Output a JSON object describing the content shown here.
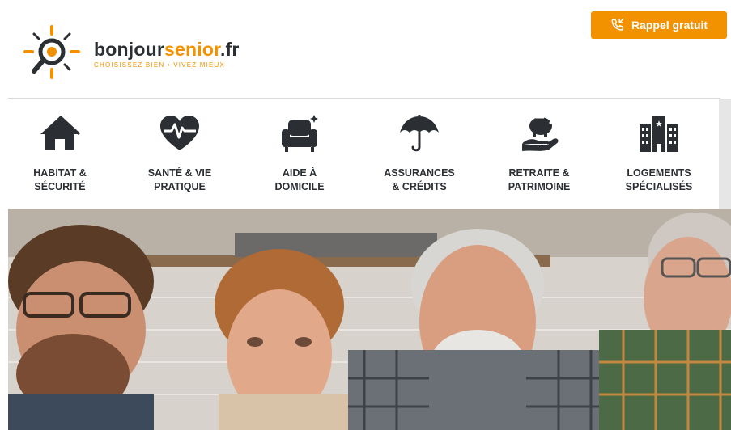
{
  "brand": {
    "name_part1": "bonjour",
    "name_part2": "senior",
    "name_part3": ".fr",
    "tagline": "CHOISISSEZ BIEN • VIVEZ MIEUX",
    "accent_color": "#f39200"
  },
  "header": {
    "callback_label": "Rappel gratuit",
    "callback_icon": "phone-callback-icon"
  },
  "nav": {
    "items": [
      {
        "line1": "HABITAT &",
        "line2": "SÉCURITÉ",
        "icon": "house-icon"
      },
      {
        "line1": "SANTÉ & VIE",
        "line2": "PRATIQUE",
        "icon": "heart-pulse-icon"
      },
      {
        "line1": "AIDE À",
        "line2": "DOMICILE",
        "icon": "armchair-icon"
      },
      {
        "line1": "ASSURANCES",
        "line2": "& CRÉDITS",
        "icon": "umbrella-icon"
      },
      {
        "line1": "RETRAITE &",
        "line2": "PATRIMOINE",
        "icon": "piggy-bank-icon"
      },
      {
        "line1": "LOGEMENTS",
        "line2": "SPÉCIALISÉS",
        "icon": "building-icon"
      }
    ]
  },
  "hero": {
    "image": "family-group-photo"
  }
}
